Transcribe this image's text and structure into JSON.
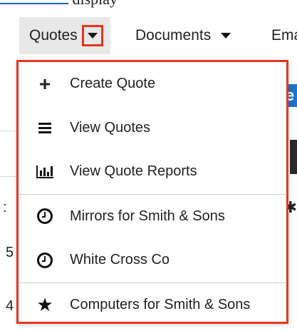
{
  "header": {
    "fragment_link": "",
    "fragment_text": "display"
  },
  "nav": {
    "quotes_label": "Quotes",
    "documents_label": "Documents",
    "email_label": "Ema"
  },
  "background": {
    "blue_letter": "e",
    "row_digits": [
      ":",
      "5",
      "4"
    ]
  },
  "dropdown": {
    "items": [
      {
        "label": "Create Quote",
        "icon": "plus-icon"
      },
      {
        "label": "View Quotes",
        "icon": "list-icon"
      },
      {
        "label": "View Quote Reports",
        "icon": "bar-chart-icon"
      },
      {
        "label": "Mirrors for Smith & Sons",
        "icon": "clock-icon"
      },
      {
        "label": "White Cross Co",
        "icon": "clock-icon"
      },
      {
        "label": "Computers for Smith & Sons",
        "icon": "star-icon"
      }
    ]
  },
  "colors": {
    "highlight": "#e8351f",
    "active_tab_bg": "#e8e8e8",
    "link": "#1a63c7"
  }
}
